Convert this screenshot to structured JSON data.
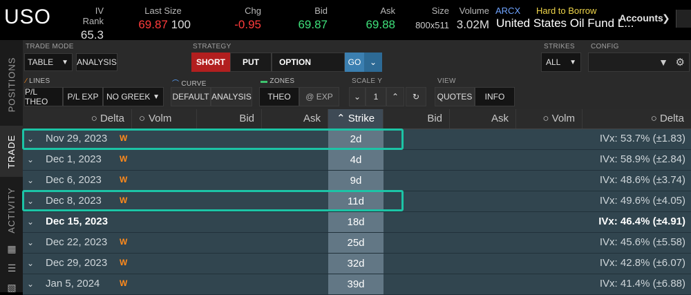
{
  "header": {
    "symbol": "USO",
    "iv_rank_label": "IV Rank",
    "iv_rank": "65.3",
    "last_size_label": "Last Size",
    "last": "69.87",
    "last_size": "100",
    "chg_label": "Chg",
    "chg": "-0.95",
    "bid_label": "Bid",
    "bid": "69.87",
    "ask_label": "Ask",
    "ask": "69.88",
    "size_label": "Size",
    "size": "800x511",
    "volume_label": "Volume",
    "volume": "3.02M",
    "exchange": "ARCX",
    "htb": "Hard to Borrow",
    "name": "United States Oil Fund L...",
    "accounts": "Accounts"
  },
  "side_tabs": [
    "POSITIONS",
    "TRADE",
    "ACTIVITY"
  ],
  "toolbar": {
    "trade_mode_label": "TRADE MODE",
    "trade_mode": "TABLE",
    "analysis": "ANALYSIS",
    "strategy_label": "STRATEGY",
    "short": "SHORT",
    "put": "PUT",
    "option": "OPTION",
    "go": "GO",
    "strikes_label": "STRIKES",
    "strikes": "ALL",
    "config_label": "CONFIG",
    "lines_label": "LINES",
    "pl_theo": "P/L THEO",
    "pl_exp": "P/L EXP",
    "no_greek": "NO GREEK",
    "curve_label": "CURVE",
    "curve_default": "DEFAULT",
    "curve_analysis": "ANALYSIS",
    "zones_label": "ZONES",
    "zones_theo": "THEO",
    "zones_exp": "@ EXP",
    "scale_label": "SCALE Y",
    "scale_value": "1",
    "view_label": "VIEW",
    "quotes": "QUOTES",
    "info": "INFO"
  },
  "columns": {
    "delta": "Delta",
    "volm": "Volm",
    "bid": "Bid",
    "ask": "Ask",
    "strike": "Strike",
    "bid2": "Bid",
    "ask2": "Ask",
    "volm2": "Volm",
    "delta2": "Delta"
  },
  "rows": [
    {
      "date": "Nov 29, 2023",
      "weekly": "W",
      "dte": "2d",
      "ivx": "IVx: 53.7% (±1.83)"
    },
    {
      "date": "Dec 1, 2023",
      "weekly": "W",
      "dte": "4d",
      "ivx": "IVx: 58.9% (±2.84)"
    },
    {
      "date": "Dec 6, 2023",
      "weekly": "W",
      "dte": "9d",
      "ivx": "IVx: 48.6% (±3.74)"
    },
    {
      "date": "Dec 8, 2023",
      "weekly": "W",
      "dte": "11d",
      "ivx": "IVx: 49.6% (±4.05)"
    },
    {
      "date": "Dec 15, 2023",
      "weekly": "",
      "dte": "18d",
      "ivx": "IVx: 46.4% (±4.91)"
    },
    {
      "date": "Dec 22, 2023",
      "weekly": "W",
      "dte": "25d",
      "ivx": "IVx: 45.6% (±5.58)"
    },
    {
      "date": "Dec 29, 2023",
      "weekly": "W",
      "dte": "32d",
      "ivx": "IVx: 42.8% (±6.07)"
    },
    {
      "date": "Jan 5, 2024",
      "weekly": "W",
      "dte": "39d",
      "ivx": "IVx: 41.4% (±6.88)"
    }
  ],
  "colors": {
    "highlight": "#1cc4a6",
    "short": "#b21f1f",
    "weekly": "#ff8a1c"
  }
}
